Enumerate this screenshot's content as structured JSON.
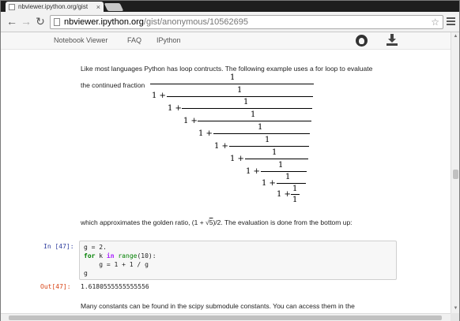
{
  "browser": {
    "tab_title": "nbviewer.ipython.org/gist",
    "tab_close": "×",
    "url_host": "nbviewer.ipython.org",
    "url_path": "/gist/anonymous/10562695",
    "back": "←",
    "forward": "→",
    "reload": "↻",
    "star": "☆"
  },
  "navbar": {
    "items": [
      "Notebook Viewer",
      "FAQ",
      "IPython"
    ]
  },
  "markdown": {
    "intro": "Like most languages Python has loop contructs. The following example uses a for loop to evaluate",
    "fraction_label": "the continued fraction",
    "golden_pre": "which approximates the golden ratio, (1 + ",
    "golden_sqrt": "5",
    "golden_post": ")/2. The evaluation is done from the bottom up:",
    "tail": "Many constants can be found in the scipy submodule constants. You can access them in the"
  },
  "fraction": {
    "one": "1",
    "one_plus": "1 +"
  },
  "code_cell": {
    "in_prompt": "In [47]:",
    "out_prompt": "Out[47]:",
    "line1": "g = 2.",
    "line2_for": "for",
    "line2_k": " k ",
    "line2_in": "in",
    "line2_range": " range",
    "line2_args": "(10):",
    "line3": "    g = 1 + 1 / g",
    "line4": "g",
    "output": "1.6180555555555556"
  }
}
